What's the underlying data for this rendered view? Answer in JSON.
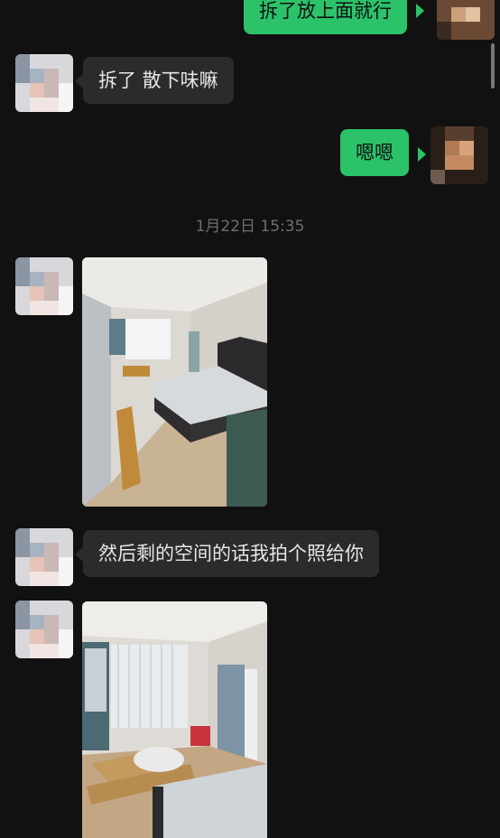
{
  "messages": [
    {
      "side": "right",
      "text": "拆了放上面就行"
    },
    {
      "side": "left",
      "text": "拆了 散下味嘛"
    },
    {
      "side": "right",
      "text": "嗯嗯"
    },
    {
      "side": "left",
      "text": "然后剩的空间的话我拍个照给你"
    }
  ],
  "timestamp": "1月22日 15:35",
  "colors": {
    "background": "#111111",
    "incoming_bubble": "#2b2b2b",
    "outgoing_bubble": "#2bc26a",
    "timestamp": "#6e6e6e"
  },
  "icons": [
    "contact-avatar",
    "self-avatar"
  ]
}
